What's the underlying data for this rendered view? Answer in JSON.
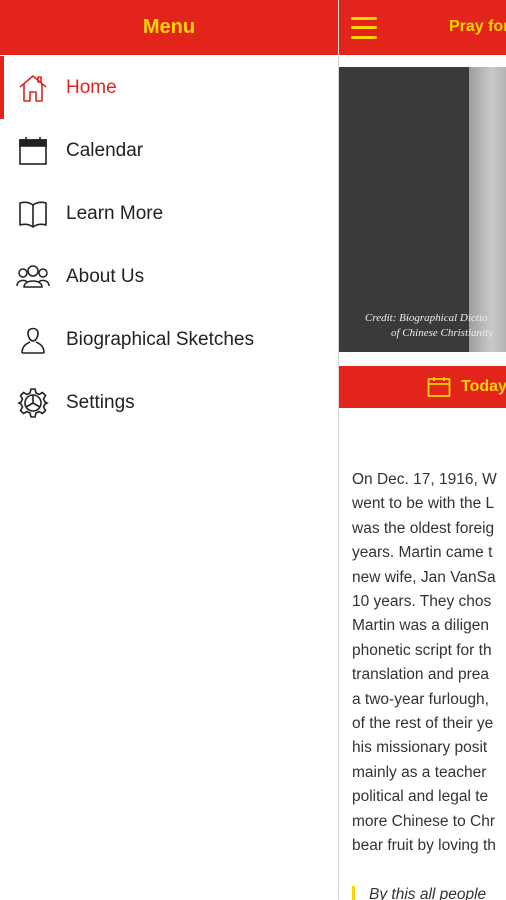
{
  "drawer": {
    "title": "Menu",
    "items": [
      {
        "label": "Home",
        "icon": "home-icon",
        "active": true
      },
      {
        "label": "Calendar",
        "icon": "calendar-icon"
      },
      {
        "label": "Learn More",
        "icon": "book-icon"
      },
      {
        "label": "About Us",
        "icon": "group-icon"
      },
      {
        "label": "Biographical Sketches",
        "icon": "person-icon"
      },
      {
        "label": "Settings",
        "icon": "gear-icon"
      }
    ]
  },
  "main": {
    "title": "Pray for",
    "photo_credit_line1": "Credit: Biographical Dictio",
    "photo_credit_line2": "of Chinese Christianity",
    "today_label": "Today",
    "article_lines": [
      "On Dec. 17, 1916, W",
      "went to be with the L",
      "was the oldest foreig",
      "years. Martin came t",
      "new wife, Jan VanSa",
      "10 years. They chos",
      "Martin was a diligen",
      "phonetic script for th",
      "translation and prea",
      "a two-year furlough,",
      "of the rest of their ye",
      "his missionary posit",
      "mainly as a teacher",
      "political and legal te",
      "more Chinese to Chr",
      "bear fruit by loving th"
    ],
    "quote": "By this all people"
  },
  "colors": {
    "brand_red": "#e3241b",
    "accent_yellow": "#ffd400"
  }
}
